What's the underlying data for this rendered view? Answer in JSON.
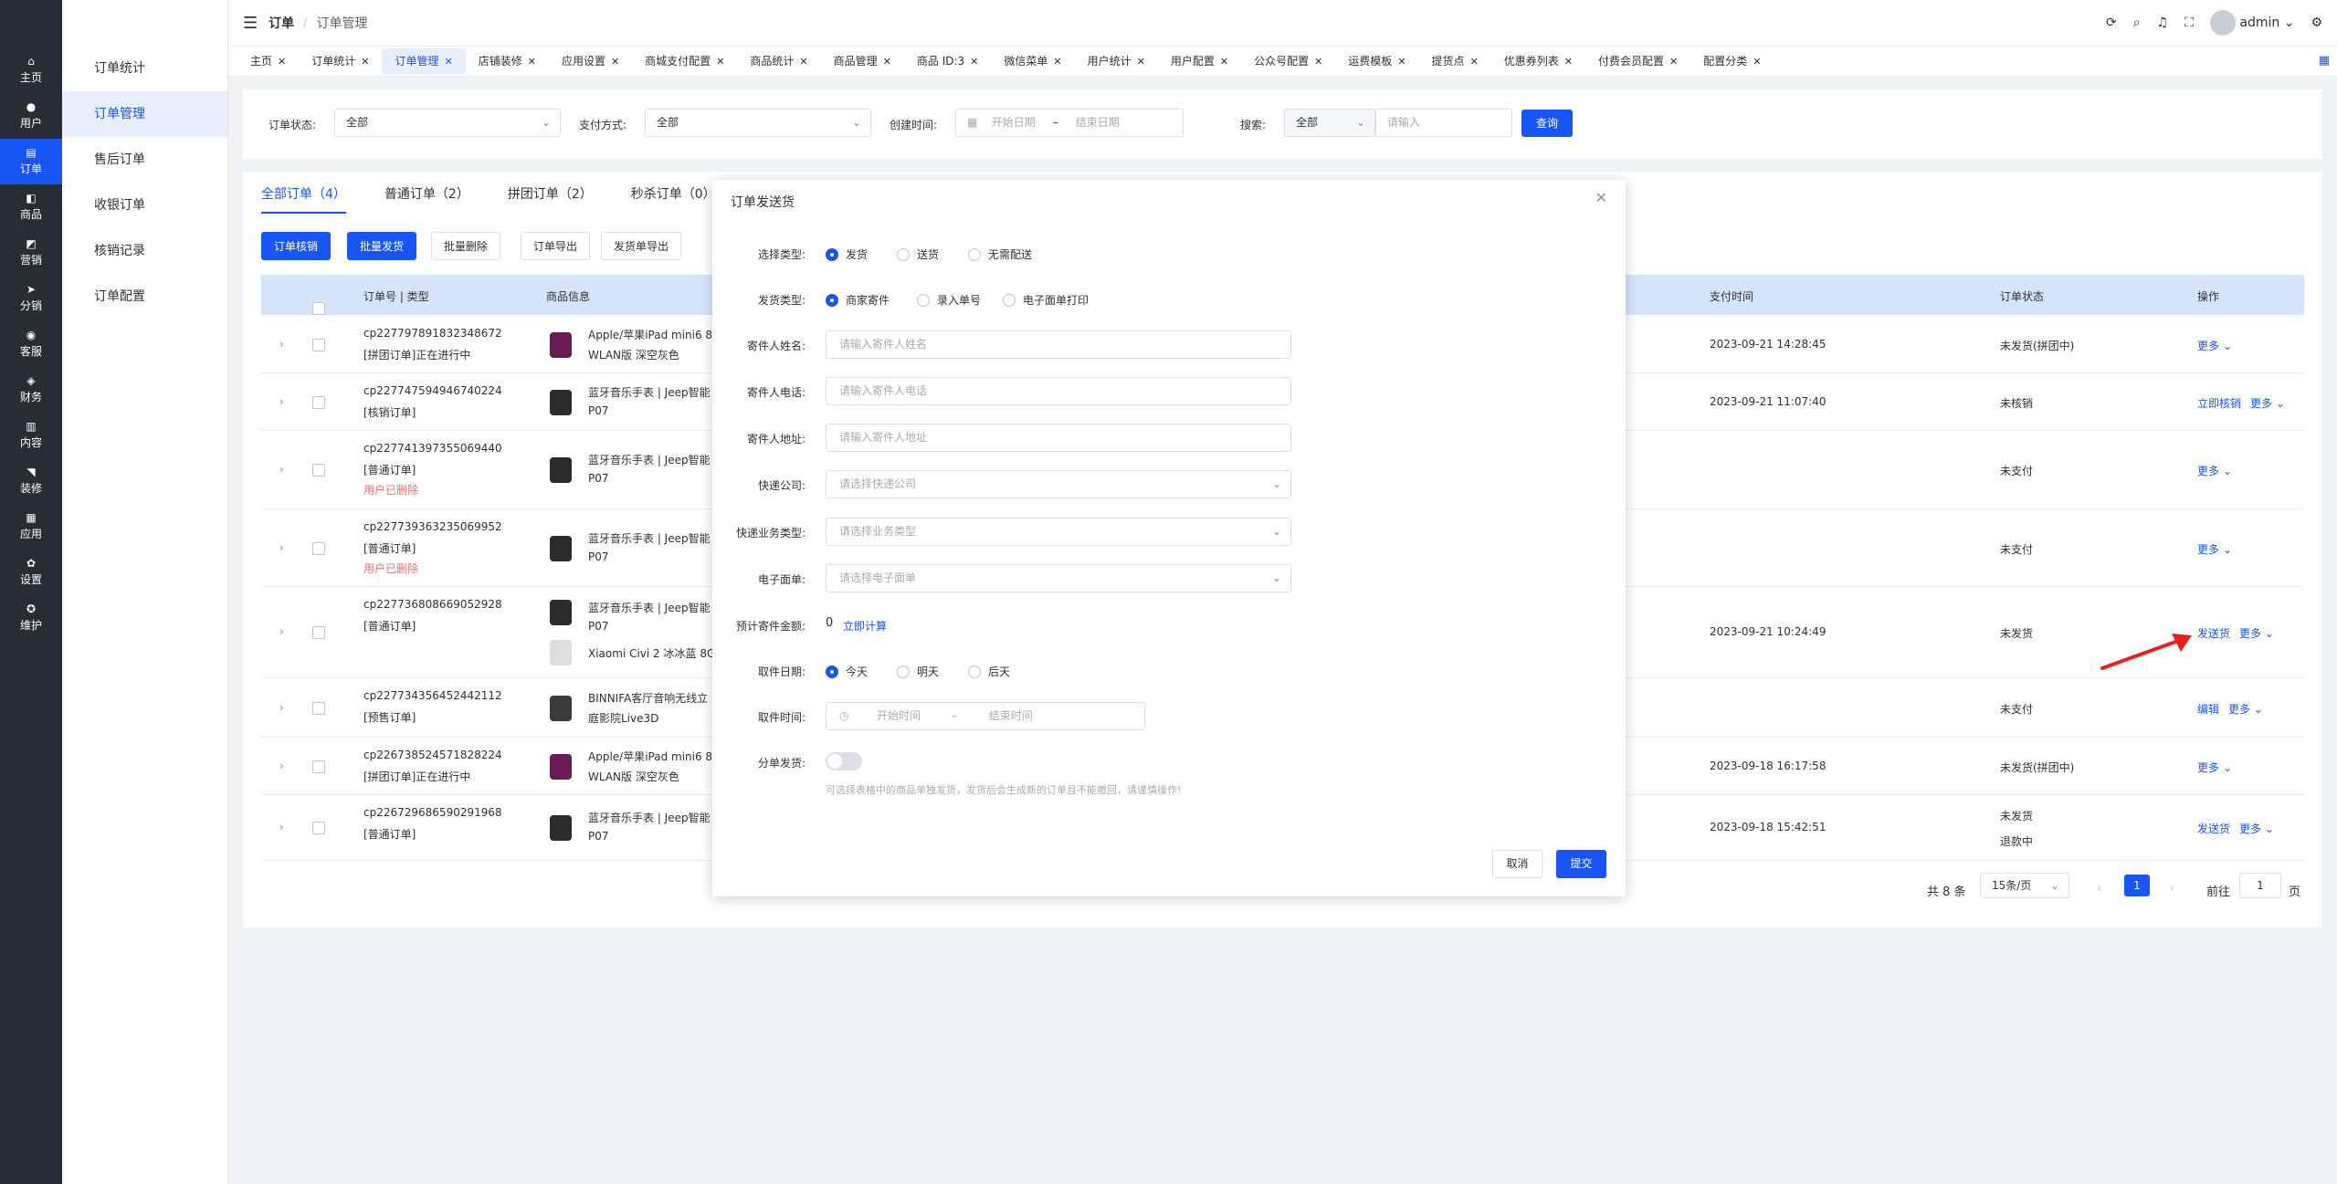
{
  "nav": [
    {
      "icon": "⌂",
      "label": "主页"
    },
    {
      "icon": "●",
      "label": "用户"
    },
    {
      "icon": "▤",
      "label": "订单"
    },
    {
      "icon": "◧",
      "label": "商品"
    },
    {
      "icon": "◩",
      "label": "营销"
    },
    {
      "icon": "➤",
      "label": "分销"
    },
    {
      "icon": "◉",
      "label": "客服"
    },
    {
      "icon": "◈",
      "label": "财务"
    },
    {
      "icon": "▥",
      "label": "内容"
    },
    {
      "icon": "◥",
      "label": "装修"
    },
    {
      "icon": "▦",
      "label": "应用"
    },
    {
      "icon": "✿",
      "label": "设置"
    },
    {
      "icon": "✪",
      "label": "维护"
    }
  ],
  "submenu": [
    "订单统计",
    "订单管理",
    "售后订单",
    "收银订单",
    "核销记录",
    "订单配置"
  ],
  "breadcrumb": {
    "level1": "订单",
    "level2": "订单管理"
  },
  "topright": {
    "user": "admin"
  },
  "tabs": [
    "主页",
    "订单统计",
    "订单管理",
    "店铺装修",
    "应用设置",
    "商城支付配置",
    "商品统计",
    "商品管理",
    "商品 ID:3",
    "微信菜单",
    "用户统计",
    "用户配置",
    "公众号配置",
    "运费模板",
    "提货点",
    "优惠券列表",
    "付费会员配置",
    "配置分类"
  ],
  "filter": {
    "status_label": "订单状态:",
    "status_value": "全部",
    "pay_label": "支付方式:",
    "pay_value": "全部",
    "time_label": "创建时间:",
    "start_ph": "开始日期",
    "end_ph": "结束日期",
    "search_label": "搜索:",
    "search_type": "全部",
    "search_ph": "请输入",
    "query_btn": "查询"
  },
  "order_tabs": [
    "全部订单（4）",
    "普通订单（2）",
    "拼团订单（2）",
    "秒杀订单（0）"
  ],
  "actions": [
    "订单核销",
    "批量发货",
    "批量删除",
    "订单导出",
    "发货单导出"
  ],
  "table": {
    "headers": {
      "order": "订单号 | 类型",
      "goods": "商品信息",
      "paytime": "支付时间",
      "status": "订单状态",
      "op": "操作"
    },
    "rows": [
      {
        "no": "cp227797891832348672",
        "type": "[拼团订单]正在进行中",
        "g1": "Apple/苹果iPad mini6 8.",
        "g2": "WLAN版 深空灰色",
        "time": "2023-09-21 14:28:45",
        "status": "未发货(拼团中)",
        "op1": "",
        "op2": "更多"
      },
      {
        "no": "cp227747594946740224",
        "type": "[核销订单]",
        "g1": "蓝牙音乐手表 | Jeep智能",
        "g2": "P07",
        "time": "2023-09-21 11:07:40",
        "status": "未核销",
        "op1": "立即核销",
        "op2": "更多"
      },
      {
        "no": "cp227741397355069440",
        "type": "[普通订单]",
        "del": "用户已删除",
        "g1": "蓝牙音乐手表 | Jeep智能",
        "g2": "P07",
        "time": "",
        "status": "未支付",
        "op1": "",
        "op2": "更多"
      },
      {
        "no": "cp227739363235069952",
        "type": "[普通订单]",
        "del": "用户已删除",
        "g1": "蓝牙音乐手表 | Jeep智能",
        "g2": "P07",
        "time": "",
        "status": "未支付",
        "op1": "",
        "op2": "更多"
      },
      {
        "no": "cp227736808669052928",
        "type": "[普通订单]",
        "g1": "蓝牙音乐手表 | Jeep智能",
        "g2": "P07",
        "g3": "Xiaomi Civi 2 冰冰蓝 8G",
        "time": "2023-09-21 10:24:49",
        "status": "未发货",
        "op1": "发送货",
        "op2": "更多"
      },
      {
        "no": "cp227734356452442112",
        "type": "[预售订单]",
        "g1": "BINNIFA客厅音响无线立",
        "g2": "庭影院Live3D",
        "time": "",
        "status": "未支付",
        "op1": "编辑",
        "op2": "更多"
      },
      {
        "no": "cp226738524571828224",
        "type": "[拼团订单]正在进行中",
        "g1": "Apple/苹果iPad mini6 8.",
        "g2": "WLAN版 深空灰色",
        "time": "2023-09-18 16:17:58",
        "status": "未发货(拼团中)",
        "op1": "",
        "op2": "更多"
      },
      {
        "no": "cp226729686590291968",
        "type": "[普通订单]",
        "g1": "蓝牙音乐手表 | Jeep智能",
        "g2": "P07",
        "time": "2023-09-18 15:42:51",
        "status": "未发货",
        "status2": "退款中",
        "op1": "发送货",
        "op2": "更多"
      }
    ]
  },
  "pager": {
    "total": "共 8 条",
    "size": "15条/页",
    "page": "1",
    "goto": "前往",
    "goto_val": "1",
    "unit": "页"
  },
  "modal": {
    "title": "订单发送货",
    "type_label": "选择类型:",
    "type_opts": [
      "发货",
      "送货",
      "无需配送"
    ],
    "ship_label": "发货类型:",
    "ship_opts": [
      "商家寄件",
      "录入单号",
      "电子面单打印"
    ],
    "name_label": "寄件人姓名:",
    "name_ph": "请输入寄件人姓名",
    "phone_label": "寄件人电话:",
    "phone_ph": "请输入寄件人电话",
    "addr_label": "寄件人地址:",
    "addr_ph": "请输入寄件人地址",
    "exp_label": "快递公司:",
    "exp_ph": "请选择快递公司",
    "biz_label": "快递业务类型:",
    "biz_ph": "请选择业务类型",
    "sheet_label": "电子面单:",
    "sheet_ph": "请选择电子面单",
    "fee_label": "预计寄件金额:",
    "fee_value": "0",
    "fee_calc": "立即计算",
    "day_label": "取件日期:",
    "day_opts": [
      "今天",
      "明天",
      "后天"
    ],
    "ptime_label": "取件时间:",
    "ptime_start": "开始时间",
    "ptime_end": "结束时间",
    "split_label": "分单发货:",
    "split_tip": "可选择表格中的商品单独发货，发货后会生成新的订单且不能撤回，请谨慎操作!",
    "cancel": "取消",
    "submit": "提交"
  },
  "colors": {
    "primary": "#1955f5",
    "danger": "#f56c6c",
    "arrow": "#e8201d"
  }
}
